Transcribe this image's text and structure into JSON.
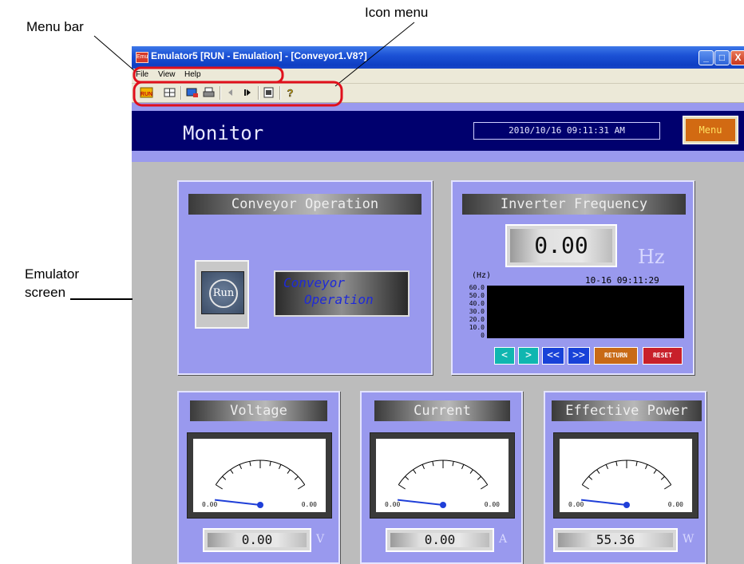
{
  "callouts": {
    "menu_bar": "Menu bar",
    "icon_menu": "Icon menu",
    "emulator_screen_line1": "Emulator",
    "emulator_screen_line2": "screen"
  },
  "window": {
    "title": "Emulator5 [RUN - Emulation] - [Conveyor1.V8?]",
    "app_icon_text": "Emu",
    "buttons": {
      "minimize": "_",
      "maximize": "□",
      "close": "X"
    }
  },
  "menu": [
    "File",
    "View",
    "Help"
  ],
  "toolbar": {
    "icons": [
      "run-mode-icon",
      "grid-icon",
      "screen-icon",
      "print-icon",
      "step-back-icon",
      "step-forward-icon",
      "page-icon",
      "help-icon"
    ]
  },
  "header": {
    "title": "Monitor",
    "datetime": "2010/10/16 09:11:31 AM",
    "menu_button": "Menu"
  },
  "conveyor": {
    "title": "Conveyor Operation",
    "run_button": "Run",
    "status_line1": "Conveyor",
    "status_line2": "Operation"
  },
  "inverter": {
    "title": "Inverter Frequency",
    "value": "0.00",
    "unit": "Hz",
    "graph_unit": "(Hz)",
    "graph_time": "10-16 09:11:29",
    "y_ticks": [
      "60.0",
      "50.0",
      "40.0",
      "30.0",
      "20.0",
      "10.0",
      "0"
    ],
    "nav": {
      "prev": "<",
      "next": ">",
      "first": "<<",
      "last": ">>",
      "return": "RETURN",
      "reset": "RESET"
    }
  },
  "meters": {
    "voltage": {
      "title": "Voltage",
      "min": "0.00",
      "max": "0.00",
      "value": "0.00",
      "unit": "V"
    },
    "current": {
      "title": "Current",
      "min": "0.00",
      "max": "0.00",
      "value": "0.00",
      "unit": "A"
    },
    "power": {
      "title": "Effective Power",
      "min": "0.00",
      "max": "0.00",
      "value": "55.36",
      "unit": "W"
    }
  },
  "colors": {
    "screen_header": "#00006e",
    "panel": "#9999ee",
    "callout_ring": "#e0101c",
    "needle": "#1f3fd8",
    "menu_button": "#d26a12",
    "nav_cyan": "#10b6b0",
    "nav_blue": "#1842d8",
    "return_btn": "#c86a16",
    "reset_btn": "#c8202a"
  }
}
